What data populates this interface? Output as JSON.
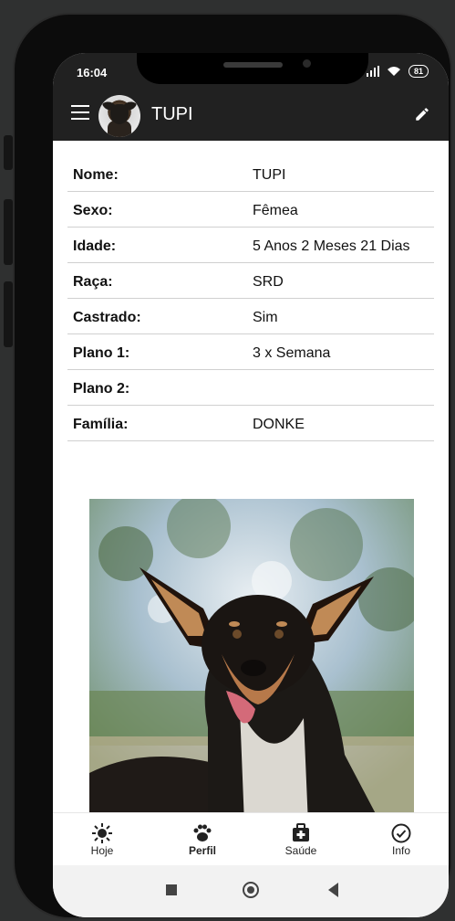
{
  "status_bar": {
    "time": "16:04",
    "battery": "81"
  },
  "app_bar": {
    "title": "TUPI"
  },
  "profile": {
    "rows": [
      {
        "label": "Nome:",
        "value": "TUPI"
      },
      {
        "label": "Sexo:",
        "value": "Fêmea"
      },
      {
        "label": "Idade:",
        "value": "5 Anos 2 Meses 21 Dias"
      },
      {
        "label": "Raça:",
        "value": "SRD"
      },
      {
        "label": "Castrado:",
        "value": "Sim"
      },
      {
        "label": "Plano 1:",
        "value": "3 x Semana"
      },
      {
        "label": "Plano 2:",
        "value": ""
      },
      {
        "label": "Família:",
        "value": "DONKE"
      }
    ]
  },
  "tabs": [
    {
      "label": "Hoje",
      "icon": "sun-icon"
    },
    {
      "label": "Perfil",
      "icon": "paw-icon",
      "active": true
    },
    {
      "label": "Saúde",
      "icon": "medical-bag-icon"
    },
    {
      "label": "Info",
      "icon": "check-circle-icon"
    }
  ],
  "colors": {
    "app_bar": "#212121",
    "background": "#ffffff",
    "divider": "#d0d0d0"
  }
}
